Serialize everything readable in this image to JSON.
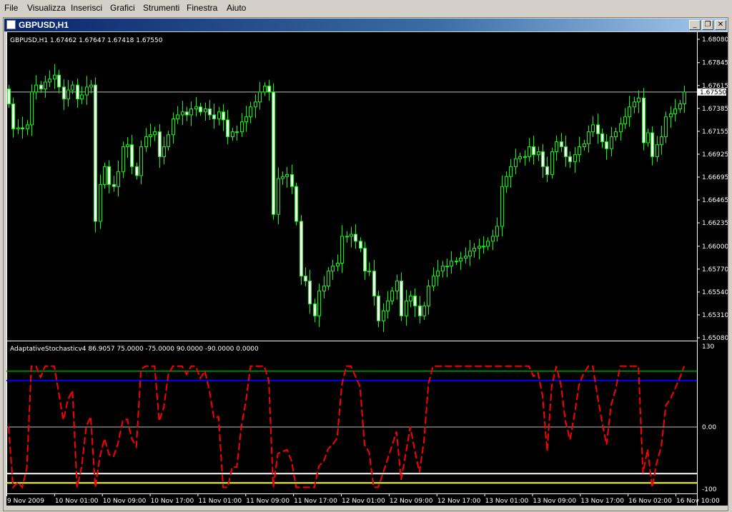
{
  "menu": [
    {
      "label": "File",
      "key": "F"
    },
    {
      "label": "Visualizza",
      "key": "V"
    },
    {
      "label": "Inserisci",
      "key": "I"
    },
    {
      "label": "Grafici",
      "key": "G"
    },
    {
      "label": "Strumenti",
      "key": "S"
    },
    {
      "label": "Finestra",
      "key": "F"
    },
    {
      "label": "Aiuto",
      "key": "A"
    }
  ],
  "window": {
    "title": "GBPUSD,H1",
    "minimize_label": "_",
    "restore_label": "❐",
    "close_label": "✕"
  },
  "price_chart": {
    "info": "GBPUSD,H1  1.67462 1.67647 1.67418 1.67550",
    "price_ticks": [
      "1.68080",
      "1.67845",
      "1.67615",
      "1.67385",
      "1.67155",
      "1.66925",
      "1.66695",
      "1.66465",
      "1.66235",
      "1.66000",
      "1.65770",
      "1.65540",
      "1.65310",
      "1.65080"
    ],
    "current_price": "1.67550",
    "colors": {
      "bull_candle": "#000000",
      "bear_candle": "#ffffff",
      "wick": "#00ff00",
      "price_line": "#c0c0c0"
    }
  },
  "indicator": {
    "info": "AdaptativeStochasticv4 86.9057 75.0000 -75.0000 90.0000 -90.0000 0.0000",
    "ticks": [
      "130",
      "0.00",
      "-100"
    ],
    "level_colors": {
      "level_90": "#008000",
      "level_75": "#0000ff",
      "level_0": "#c0c0c0",
      "level_m75": "#ffffff",
      "level_m90": "#ffff00",
      "line": "#ff0000"
    }
  },
  "time_axis": [
    "9 Nov 2009",
    "10 Nov 01:00",
    "10 Nov 09:00",
    "10 Nov 17:00",
    "11 Nov 01:00",
    "11 Nov 09:00",
    "11 Nov 17:00",
    "12 Nov 01:00",
    "12 Nov 09:00",
    "12 Nov 17:00",
    "13 Nov 01:00",
    "13 Nov 09:00",
    "13 Nov 17:00",
    "16 Nov 02:00",
    "16 Nov 10:00"
  ],
  "chart_data": {
    "type": "candlestick",
    "symbol": "GBPUSD",
    "timeframe": "H1",
    "y_range": [
      1.6508,
      1.6808
    ],
    "closes": [
      1.6743,
      1.6718,
      1.6719,
      1.6718,
      1.6722,
      1.6755,
      1.6762,
      1.6758,
      1.6765,
      1.6768,
      1.6772,
      1.676,
      1.6748,
      1.6757,
      1.6762,
      1.6748,
      1.6752,
      1.676,
      1.6762,
      1.6625,
      1.6662,
      1.668,
      1.6662,
      1.666,
      1.6675,
      1.67,
      1.6702,
      1.668,
      1.6671,
      1.67,
      1.671,
      1.6712,
      1.6715,
      1.669,
      1.67,
      1.6712,
      1.6728,
      1.6732,
      1.6735,
      1.6732,
      1.6738,
      1.674,
      1.6735,
      1.6738,
      1.6732,
      1.6728,
      1.6735,
      1.6727,
      1.671,
      1.6715,
      1.6715,
      1.6725,
      1.673,
      1.674,
      1.6745,
      1.6755,
      1.6761,
      1.6755,
      1.6632,
      1.6668,
      1.667,
      1.6672,
      1.666,
      1.6625,
      1.657,
      1.6565,
      1.6542,
      1.653,
      1.6555,
      1.656,
      1.6575,
      1.658,
      1.6583,
      1.661,
      1.661,
      1.6612,
      1.6605,
      1.6598,
      1.6575,
      1.6575,
      1.655,
      1.6525,
      1.6535,
      1.6545,
      1.6555,
      1.6565,
      1.653,
      1.6545,
      1.655,
      1.654,
      1.653,
      1.654,
      1.656,
      1.657,
      1.6575,
      1.658,
      1.658,
      1.6585,
      1.6585,
      1.6588,
      1.659,
      1.6595,
      1.6598,
      1.66,
      1.66,
      1.6605,
      1.661,
      1.662,
      1.666,
      1.667,
      1.668,
      1.6688,
      1.669,
      1.669,
      1.67,
      1.6692,
      1.6695,
      1.668,
      1.6672,
      1.6695,
      1.6705,
      1.67,
      1.669,
      1.6685,
      1.6692,
      1.67,
      1.6703,
      1.6715,
      1.6722,
      1.6713,
      1.6705,
      1.6698,
      1.671,
      1.6715,
      1.6723,
      1.673,
      1.674,
      1.6745,
      1.6749,
      1.6704,
      1.6714,
      1.669,
      1.6702,
      1.671,
      1.673,
      1.6733,
      1.6738,
      1.6743,
      1.6755
    ],
    "indicator_levels": [
      90,
      75,
      0,
      -75,
      -90
    ],
    "indicator_range": [
      -100,
      130
    ]
  }
}
